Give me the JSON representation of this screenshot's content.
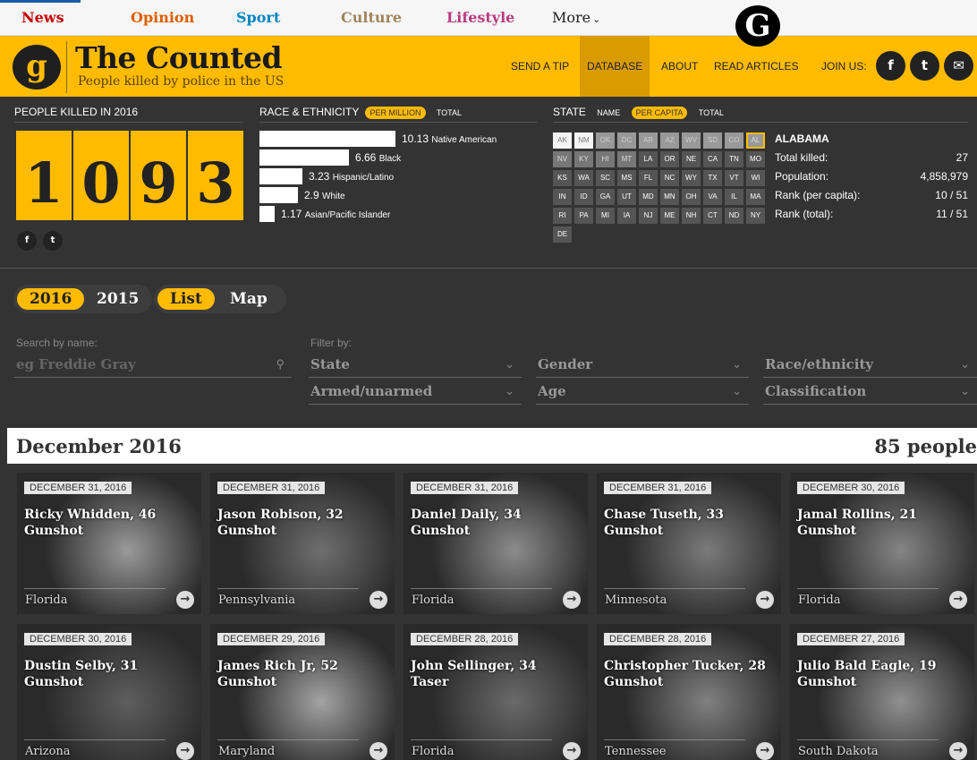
{
  "topnav": {
    "items": [
      {
        "label": "News",
        "color": "#c70000"
      },
      {
        "label": "Opinion",
        "color": "#e05e00"
      },
      {
        "label": "Sport",
        "color": "#0084c6"
      },
      {
        "label": "Culture",
        "color": "#a1845c"
      },
      {
        "label": "Lifestyle",
        "color": "#bb3b80"
      }
    ],
    "more_label": "More",
    "logo_glyph": "G"
  },
  "header": {
    "logo_glyph": "g",
    "title": "The Counted",
    "subtitle": "People killed by police in the US",
    "nav": [
      "SEND A TIP",
      "DATABASE",
      "ABOUT",
      "READ ARTICLES"
    ],
    "join_label": "JOIN US:",
    "share_icons": [
      "f",
      "t",
      "✉"
    ]
  },
  "killed": {
    "label": "PEOPLE KILLED IN 2016",
    "digits": [
      "1",
      "0",
      "9",
      "3"
    ],
    "social": [
      "f",
      "t"
    ]
  },
  "race": {
    "label": "RACE & ETHNICITY",
    "toggle_on": "PER MILLION",
    "toggle_off": "TOTAL",
    "rows": [
      {
        "value": "10.13",
        "name": "Native American",
        "fraction": 1.0
      },
      {
        "value": "6.66",
        "name": "Black",
        "fraction": 0.657
      },
      {
        "value": "3.23",
        "name": "Hispanic/Latino",
        "fraction": 0.319
      },
      {
        "value": "2.9",
        "name": "White",
        "fraction": 0.286
      },
      {
        "value": "1.17",
        "name": "Asian/Pacific Islander",
        "fraction": 0.115
      }
    ]
  },
  "state": {
    "label": "STATE",
    "toggle_name": "NAME",
    "toggle_on": "PER CAPITA",
    "toggle_total": "TOTAL",
    "rows": [
      [
        {
          "c": "AK",
          "t": "w"
        },
        {
          "c": "NM",
          "t": "w"
        },
        {
          "c": "OK",
          "t": "l"
        },
        {
          "c": "DC",
          "t": "l"
        },
        {
          "c": "AR",
          "t": "l"
        },
        {
          "c": "AZ",
          "t": "l"
        },
        {
          "c": "WV",
          "t": "l"
        },
        {
          "c": "SD",
          "t": "l"
        },
        {
          "c": "CO",
          "t": "l"
        },
        {
          "c": "AL",
          "t": "sel"
        }
      ],
      [
        {
          "c": "NV",
          "t": "m"
        },
        {
          "c": "KY",
          "t": "m"
        },
        {
          "c": "HI",
          "t": "m"
        },
        {
          "c": "MT",
          "t": "m"
        },
        {
          "c": "LA",
          "t": "d"
        },
        {
          "c": "OR",
          "t": "d"
        },
        {
          "c": "NE",
          "t": "d"
        },
        {
          "c": "CA",
          "t": "d"
        },
        {
          "c": "TN",
          "t": "d"
        },
        {
          "c": "MO",
          "t": "d"
        }
      ],
      [
        {
          "c": "KS",
          "t": "d"
        },
        {
          "c": "WA",
          "t": "d"
        },
        {
          "c": "SC",
          "t": "d"
        },
        {
          "c": "MS",
          "t": "d"
        },
        {
          "c": "FL",
          "t": "d"
        },
        {
          "c": "NC",
          "t": "d"
        },
        {
          "c": "WY",
          "t": "d"
        },
        {
          "c": "TX",
          "t": "d"
        },
        {
          "c": "VT",
          "t": "d"
        },
        {
          "c": "WI",
          "t": "d"
        }
      ],
      [
        {
          "c": "IN",
          "t": "d"
        },
        {
          "c": "ID",
          "t": "d"
        },
        {
          "c": "GA",
          "t": "d"
        },
        {
          "c": "UT",
          "t": "d"
        },
        {
          "c": "MD",
          "t": "d"
        },
        {
          "c": "MN",
          "t": "d"
        },
        {
          "c": "OH",
          "t": "d"
        },
        {
          "c": "VA",
          "t": "d"
        },
        {
          "c": "IL",
          "t": "d"
        },
        {
          "c": "MA",
          "t": "d"
        }
      ],
      [
        {
          "c": "RI",
          "t": "d"
        },
        {
          "c": "PA",
          "t": "d"
        },
        {
          "c": "MI",
          "t": "d"
        },
        {
          "c": "IA",
          "t": "d"
        },
        {
          "c": "NJ",
          "t": "d"
        },
        {
          "c": "ME",
          "t": "d"
        },
        {
          "c": "NH",
          "t": "d"
        },
        {
          "c": "CT",
          "t": "d"
        },
        {
          "c": "ND",
          "t": "d"
        },
        {
          "c": "NY",
          "t": "d"
        }
      ],
      [
        {
          "c": "DE",
          "t": "d"
        }
      ]
    ],
    "selected": {
      "name": "ALABAMA",
      "stats": [
        {
          "k": "Total killed:",
          "v": "27"
        },
        {
          "k": "Population:",
          "v": "4,858,979"
        },
        {
          "k": "Rank (per capita):",
          "v": "10 / 51"
        },
        {
          "k": "Rank (total):",
          "v": "11 / 51"
        }
      ]
    }
  },
  "toggles": {
    "year_on": "2016",
    "year_off": "2015",
    "view_on": "List",
    "view_off": "Map"
  },
  "filters": {
    "search_label": "Search by name:",
    "search_placeholder": "eg Freddie Gray",
    "filter_label": "Filter by:",
    "fields": [
      "State",
      "Gender",
      "Race/ethnicity",
      "Armed/unarmed",
      "Age",
      "Classification"
    ]
  },
  "month": {
    "name": "December 2016",
    "count": "85 people"
  },
  "cards": [
    {
      "date": "DECEMBER 31, 2016",
      "name": "Ricky Whidden, 46",
      "cause": "Gunshot",
      "location": "Florida",
      "tone": "#9a9a9a"
    },
    {
      "date": "DECEMBER 31, 2016",
      "name": "Jason Robison, 32",
      "cause": "Gunshot",
      "location": "Pennsylvania",
      "tone": "#6f6f6f"
    },
    {
      "date": "DECEMBER 31, 2016",
      "name": "Daniel Daily, 34",
      "cause": "Gunshot",
      "location": "Florida",
      "tone": "#8c8c8c"
    },
    {
      "date": "DECEMBER 31, 2016",
      "name": "Chase Tuseth, 33",
      "cause": "Gunshot",
      "location": "Minnesota",
      "tone": "#7b7b7b"
    },
    {
      "date": "DECEMBER 30, 2016",
      "name": "Jamal Rollins, 21",
      "cause": "Gunshot",
      "location": "Florida",
      "tone": "#858585"
    },
    {
      "date": "DECEMBER 30, 2016",
      "name": "Dustin Selby, 31",
      "cause": "Gunshot",
      "location": "Arizona",
      "tone": "#5e5e5e"
    },
    {
      "date": "DECEMBER 29, 2016",
      "name": "James Rich Jr, 52",
      "cause": "Gunshot",
      "location": "Maryland",
      "tone": "#a3a3a3"
    },
    {
      "date": "DECEMBER 28, 2016",
      "name": "John Sellinger, 34",
      "cause": "Taser",
      "location": "Florida",
      "tone": "#6a6a6a"
    },
    {
      "date": "DECEMBER 28, 2016",
      "name": "Christopher Tucker, 28",
      "cause": "Gunshot",
      "location": "Tennessee",
      "tone": "#808080"
    },
    {
      "date": "DECEMBER 27, 2016",
      "name": "Julio Bald Eagle, 19",
      "cause": "Gunshot",
      "location": "South Dakota",
      "tone": "#909090"
    }
  ]
}
